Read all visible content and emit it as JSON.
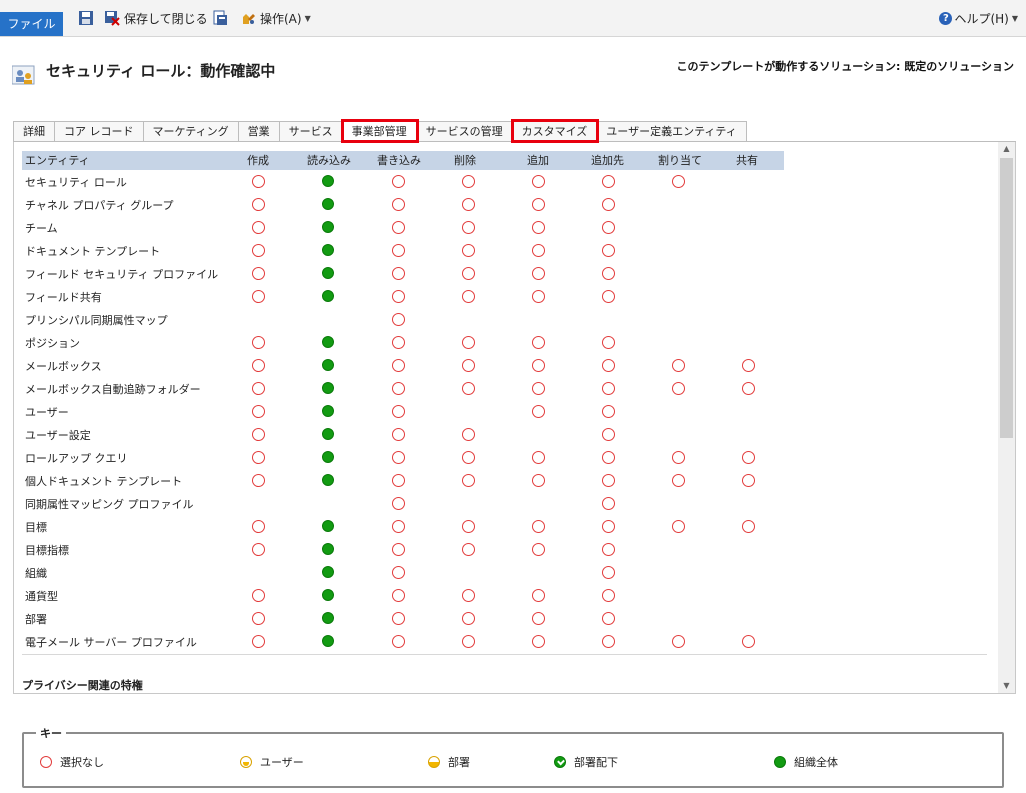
{
  "ribbon": {
    "file": "ファイル",
    "save_close": "保存して閉じる",
    "actions": "操作(A)",
    "help": "ヘルプ(H)"
  },
  "header": {
    "title": "セキュリティ ロール：動作確認中",
    "solution": "このテンプレートが動作するソリューション: 既定のソリューション"
  },
  "tabs": [
    {
      "label": "詳細",
      "highlight": false
    },
    {
      "label": "コア レコード",
      "highlight": false
    },
    {
      "label": "マーケティング",
      "highlight": false
    },
    {
      "label": "営業",
      "highlight": false
    },
    {
      "label": "サービス",
      "highlight": false
    },
    {
      "label": "事業部管理",
      "highlight": true,
      "active": true
    },
    {
      "label": "サービスの管理",
      "highlight": false
    },
    {
      "label": "カスタマイズ",
      "highlight": true
    },
    {
      "label": "ユーザー定義エンティティ",
      "highlight": false
    }
  ],
  "columns": [
    "エンティティ",
    "作成",
    "読み込み",
    "書き込み",
    "削除",
    "追加",
    "追加先",
    "割り当て",
    "共有"
  ],
  "rows": [
    {
      "entity": "セキュリティ ロール",
      "p": [
        "none",
        "org",
        "none",
        "none",
        "none",
        "none",
        "none",
        ""
      ]
    },
    {
      "entity": "チャネル プロパティ グループ",
      "p": [
        "none",
        "org",
        "none",
        "none",
        "none",
        "none",
        "",
        ""
      ]
    },
    {
      "entity": "チーム",
      "p": [
        "none",
        "org",
        "none",
        "none",
        "none",
        "none",
        "",
        ""
      ]
    },
    {
      "entity": "ドキュメント テンプレート",
      "p": [
        "none",
        "org",
        "none",
        "none",
        "none",
        "none",
        "",
        ""
      ]
    },
    {
      "entity": "フィールド セキュリティ プロファイル",
      "p": [
        "none",
        "org",
        "none",
        "none",
        "none",
        "none",
        "",
        ""
      ]
    },
    {
      "entity": "フィールド共有",
      "p": [
        "none",
        "org",
        "none",
        "none",
        "none",
        "none",
        "",
        ""
      ]
    },
    {
      "entity": "プリンシパル同期属性マップ",
      "p": [
        "",
        "",
        "none",
        "",
        "",
        "",
        "",
        ""
      ]
    },
    {
      "entity": "ポジション",
      "p": [
        "none",
        "org",
        "none",
        "none",
        "none",
        "none",
        "",
        ""
      ]
    },
    {
      "entity": "メールボックス",
      "p": [
        "none",
        "org",
        "none",
        "none",
        "none",
        "none",
        "none",
        "none"
      ]
    },
    {
      "entity": "メールボックス自動追跡フォルダー",
      "p": [
        "none",
        "org",
        "none",
        "none",
        "none",
        "none",
        "none",
        "none"
      ]
    },
    {
      "entity": "ユーザー",
      "p": [
        "none",
        "org",
        "none",
        "",
        "none",
        "none",
        "",
        ""
      ]
    },
    {
      "entity": "ユーザー設定",
      "p": [
        "none",
        "org",
        "none",
        "none",
        "",
        "none",
        "",
        ""
      ]
    },
    {
      "entity": "ロールアップ クエリ",
      "p": [
        "none",
        "org",
        "none",
        "none",
        "none",
        "none",
        "none",
        "none"
      ]
    },
    {
      "entity": "個人ドキュメント テンプレート",
      "p": [
        "none",
        "org",
        "none",
        "none",
        "none",
        "none",
        "none",
        "none"
      ]
    },
    {
      "entity": "同期属性マッピング プロファイル",
      "p": [
        "",
        "",
        "none",
        "",
        "",
        "none",
        "",
        ""
      ]
    },
    {
      "entity": "目標",
      "p": [
        "none",
        "org",
        "none",
        "none",
        "none",
        "none",
        "none",
        "none"
      ]
    },
    {
      "entity": "目標指標",
      "p": [
        "none",
        "org",
        "none",
        "none",
        "none",
        "none",
        "",
        ""
      ]
    },
    {
      "entity": "組織",
      "p": [
        "",
        "org",
        "none",
        "",
        "",
        "none",
        "",
        ""
      ]
    },
    {
      "entity": "通貨型",
      "p": [
        "none",
        "org",
        "none",
        "none",
        "none",
        "none",
        "",
        ""
      ]
    },
    {
      "entity": "部署",
      "p": [
        "none",
        "org",
        "none",
        "none",
        "none",
        "none",
        "",
        ""
      ]
    },
    {
      "entity": "電子メール サーバー プロファイル",
      "p": [
        "none",
        "org",
        "none",
        "none",
        "none",
        "none",
        "none",
        "none"
      ]
    }
  ],
  "privacy_label": "プライバシー関連の特権",
  "key": {
    "label": "キー",
    "items": [
      {
        "name": "none",
        "label": "選択なし"
      },
      {
        "name": "user",
        "label": "ユーザー"
      },
      {
        "name": "bu",
        "label": "部署"
      },
      {
        "name": "pbu",
        "label": "部署配下"
      },
      {
        "name": "org",
        "label": "組織全体"
      }
    ]
  },
  "colors": {
    "accent": "#2672c8",
    "highlight": "#e8000e",
    "org": "#129b12",
    "none": "#e23c3c",
    "header": "#c6d4e6"
  }
}
